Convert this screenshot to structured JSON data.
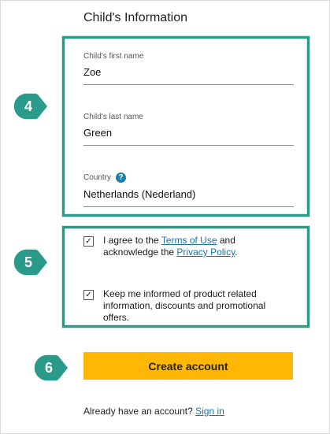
{
  "section": {
    "title": "Child's Information"
  },
  "fields": {
    "first_name": {
      "label": "Child's first name",
      "value": "Zoe"
    },
    "last_name": {
      "label": "Child's last name",
      "value": "Green"
    },
    "country": {
      "label": "Country",
      "help": "?",
      "value": "Netherlands (Nederland)"
    }
  },
  "consent": {
    "terms": {
      "checked": true,
      "check_glyph": "✓",
      "prefix": "I agree to the ",
      "terms_link": "Terms of Use",
      "middle": " and acknowledge the ",
      "privacy_link": "Privacy Policy",
      "suffix": "."
    },
    "marketing": {
      "checked": true,
      "check_glyph": "✓",
      "text": "Keep me informed of product related information, discounts and promotional offers."
    }
  },
  "actions": {
    "create_label": "Create account"
  },
  "signin": {
    "prompt": "Already have an account? ",
    "link": "Sign in"
  },
  "markers": {
    "step4": "4",
    "step5": "5",
    "step6": "6"
  },
  "colors": {
    "marker_teal": "#2a9b8a",
    "button_yellow": "#ffb703",
    "link_blue": "#1a73a8"
  }
}
